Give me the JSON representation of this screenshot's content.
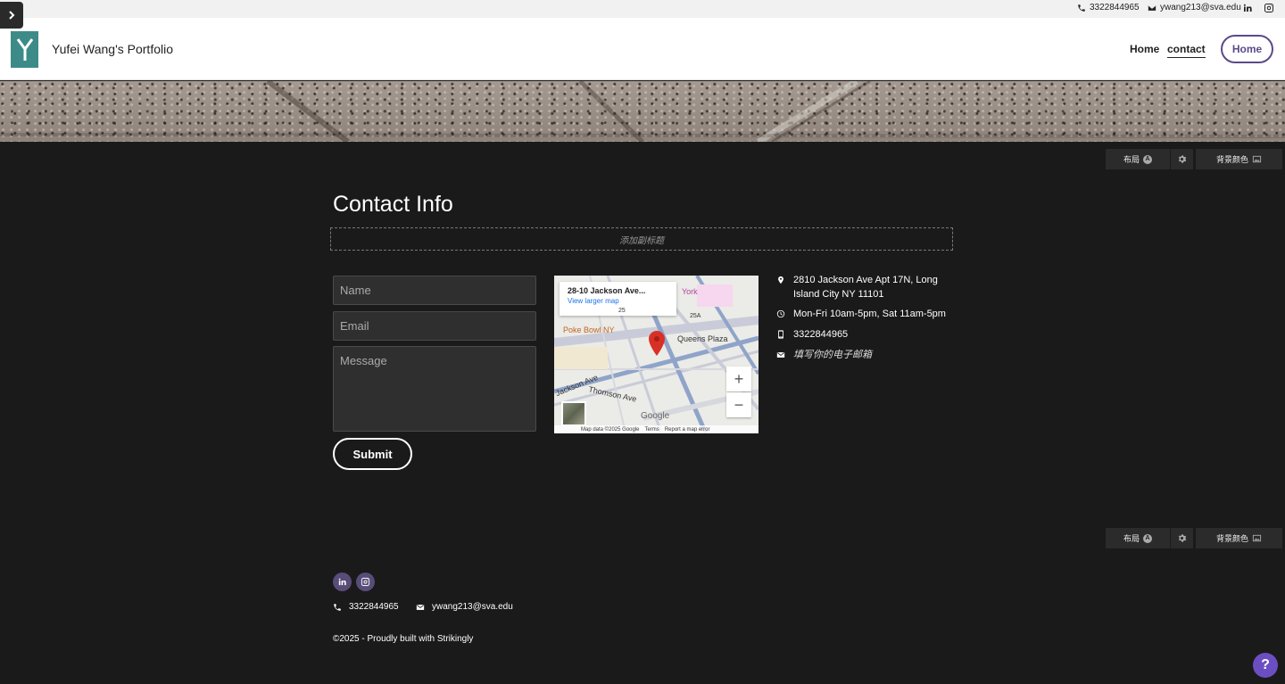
{
  "topbar": {
    "phone": "3322844965",
    "email": "ywang213@sva.edu",
    "icons": [
      "phone-icon",
      "mail-icon",
      "linkedin-icon",
      "instagram-icon"
    ]
  },
  "header": {
    "site_title": "Yufei Wang's Portfolio",
    "nav": {
      "home": "Home",
      "contact": "contact",
      "button": "Home"
    }
  },
  "editor_controls": {
    "layout": "布局",
    "layout_badge": "A",
    "background_color": "背景颜色"
  },
  "contact": {
    "title": "Contact Info",
    "subtitle_placeholder": "添加副标题",
    "form": {
      "name_placeholder": "Name",
      "email_placeholder": "Email",
      "message_placeholder": "Message",
      "submit_label": "Submit"
    },
    "map": {
      "card_address": "28-10 Jackson Ave...",
      "card_link": "View larger map",
      "labels": {
        "poke_bowl": "Poke Bowl NY",
        "queens_plaza": "Queens Plaza",
        "jackson_ave": "Jackson Ave",
        "thomson_ave": "Thomson Ave",
        "york": "York",
        "route_25": "25",
        "route_25a": "25A"
      },
      "zoom_in": "+",
      "zoom_out": "−",
      "google": "Google",
      "footer": {
        "data": "Map data ©2025 Google",
        "terms": "Terms",
        "report": "Report a map error"
      }
    },
    "info": {
      "address": "2810 Jackson Ave Apt 17N, Long Island City NY 11101",
      "hours": "Mon-Fri 10am-5pm, Sat 11am-5pm",
      "phone": "3322844965",
      "email_placeholder": "填写你的电子邮箱"
    }
  },
  "footer": {
    "phone": "3322844965",
    "email": "ywang213@sva.edu",
    "copyright": "©2025 - Proudly built with Strikingly"
  },
  "help": {
    "label": "?"
  },
  "colors": {
    "dark_bg": "#1b1a1a",
    "accent_purple": "#5a4a8a",
    "logo_teal": "#3d8b88",
    "help_purple": "#6b4fc2"
  }
}
